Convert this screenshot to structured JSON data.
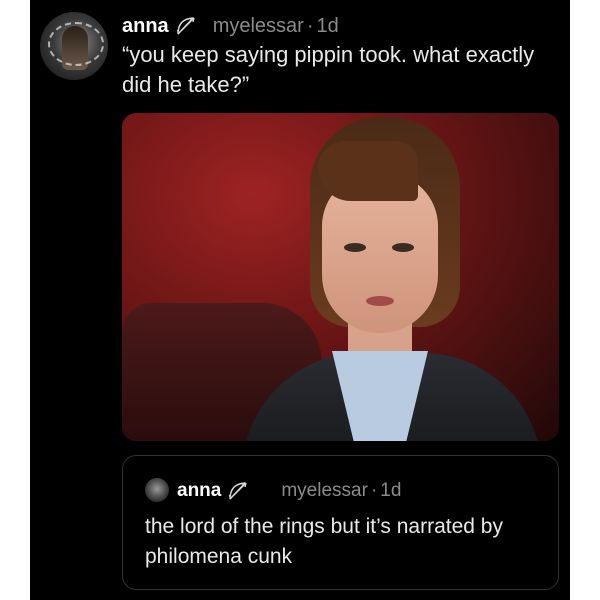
{
  "post": {
    "author_name": "anna",
    "handle": "myelessar",
    "separator": "·",
    "time": "1d",
    "text": "“you keep saying pippin took. what exactly did he take?”",
    "author_badge_icon": "bow-and-arrow-icon",
    "media_image": "photo of a woman in a dark blazer and light blue shirt in front of a red background"
  },
  "quoted_post": {
    "author_name": "anna",
    "handle": "myelessar",
    "separator": "·",
    "time": "1d",
    "text": "the lord of the rings but it’s narrated by philomena cunk",
    "author_badge_icon": "bow-and-arrow-icon"
  },
  "colors": {
    "background": "#000000",
    "primary_text": "#e9e9e9",
    "secondary_text": "#8b8b8b",
    "border": "#2f3336"
  }
}
